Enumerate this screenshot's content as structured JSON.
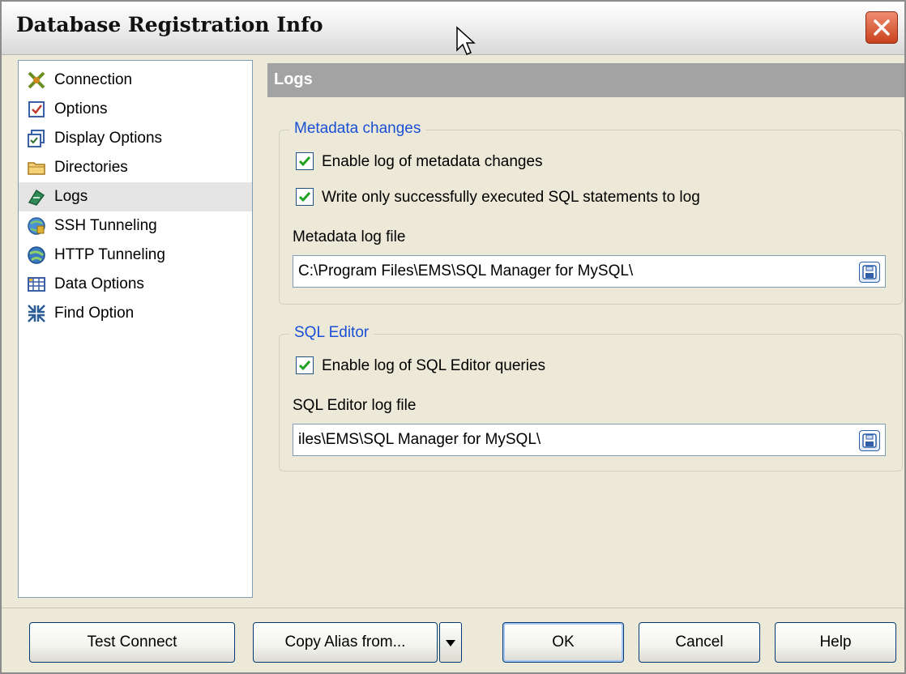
{
  "window": {
    "title": "Database Registration Info"
  },
  "nav": {
    "items": [
      {
        "label": "Connection",
        "icon": "connection-icon"
      },
      {
        "label": "Options",
        "icon": "options-icon"
      },
      {
        "label": "Display Options",
        "icon": "display-options-icon"
      },
      {
        "label": "Directories",
        "icon": "folder-icon"
      },
      {
        "label": "Logs",
        "icon": "logs-icon",
        "selected": true
      },
      {
        "label": "SSH Tunneling",
        "icon": "ssh-icon"
      },
      {
        "label": "HTTP Tunneling",
        "icon": "http-icon"
      },
      {
        "label": "Data Options",
        "icon": "data-options-icon"
      },
      {
        "label": "Find Option",
        "icon": "find-option-icon"
      }
    ]
  },
  "panel": {
    "title": "Logs"
  },
  "metadata": {
    "legend": "Metadata changes",
    "enable_log_label": "Enable log of metadata changes",
    "enable_log_checked": true,
    "success_only_label": "Write only successfully executed SQL statements to log",
    "success_only_checked": true,
    "file_label": "Metadata log file",
    "file_value": "C:\\Program Files\\EMS\\SQL Manager for MySQL\\"
  },
  "sql_editor": {
    "legend": "SQL Editor",
    "enable_log_label": "Enable log of SQL Editor queries",
    "enable_log_checked": true,
    "file_label": "SQL Editor log file",
    "file_value": "iles\\EMS\\SQL Manager for MySQL\\"
  },
  "buttons": {
    "test_connect": "Test Connect",
    "copy_alias": "Copy Alias from...",
    "ok": "OK",
    "cancel": "Cancel",
    "help": "Help"
  },
  "colors": {
    "legend_text": "#1a4fd6",
    "header_bg": "#a3a3a3",
    "dialog_bg": "#ece9d8"
  }
}
